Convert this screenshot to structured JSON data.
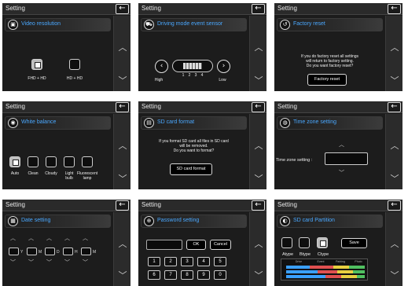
{
  "common": {
    "setting_label": "Setting",
    "back_glyph": "←",
    "up_glyph": "︿",
    "down_glyph": "﹀"
  },
  "panels": [
    {
      "header": "Video resolution",
      "options": [
        "FHD + HD",
        "HD + HD"
      ]
    },
    {
      "header": "Driving mode event sensor",
      "high": "High",
      "low": "Low",
      "ticks": [
        "1",
        "2",
        "3",
        "4"
      ]
    },
    {
      "header": "Factory reset",
      "message": [
        "If you do factory reset all settings",
        "will return to factory setting.",
        "Do you want factory reset?"
      ],
      "button": "Factory reset"
    },
    {
      "header": "White balance",
      "options": [
        "Auto",
        "Clean",
        "Cloudy",
        "Light bulb",
        "Fluorescent lamp"
      ]
    },
    {
      "header": "SD card format",
      "message": [
        "If you format SD card all files in SD card",
        "will be removed.",
        "Do you want to format?"
      ],
      "button": "SD card format"
    },
    {
      "header": "Time zone setting",
      "label": "Time zone setting :"
    },
    {
      "header": "Date setting",
      "seps": [
        "Y",
        "M",
        "D",
        "H",
        "M"
      ]
    },
    {
      "header": "Password setting",
      "ok": "OK",
      "cancel": "Cancel",
      "keys": [
        "1",
        "2",
        "3",
        "4",
        "5",
        "6",
        "7",
        "8",
        "9",
        "0"
      ]
    },
    {
      "header": "SD card Partition",
      "save": "Save",
      "types": [
        "Atype",
        "Btype",
        "Ctype"
      ],
      "table_head": [
        "Drive",
        "Event",
        "Parking",
        "Photo"
      ]
    }
  ]
}
